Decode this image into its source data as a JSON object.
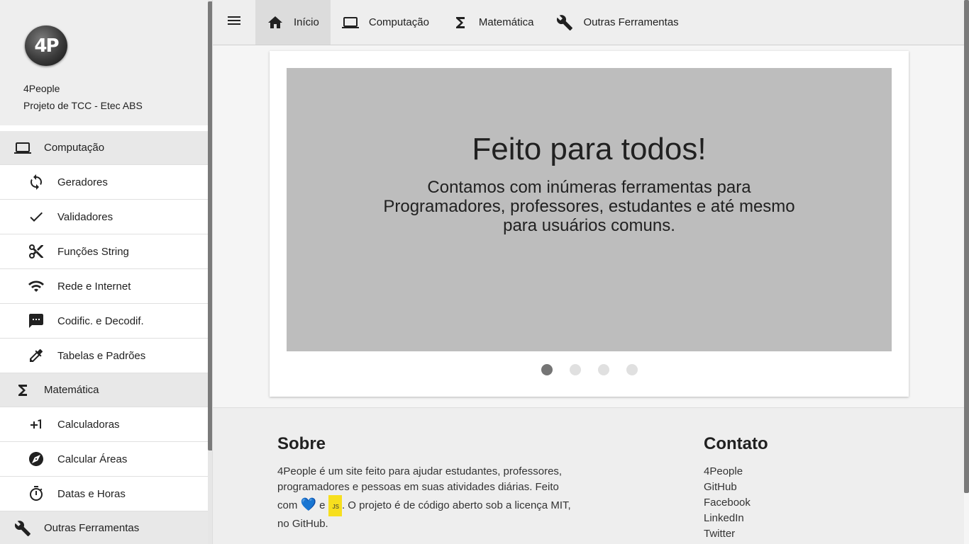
{
  "sidebar": {
    "profile": {
      "name": "4People",
      "subtitle": "Projeto de TCC - Etec ABS",
      "logo_text": "4P"
    },
    "sections": [
      {
        "label": "Computação",
        "icon": "laptop-icon",
        "items": [
          {
            "label": "Geradores",
            "icon": "refresh-icon"
          },
          {
            "label": "Validadores",
            "icon": "check-icon"
          },
          {
            "label": "Funções String",
            "icon": "scissors-icon"
          },
          {
            "label": "Rede e Internet",
            "icon": "wifi-icon"
          },
          {
            "label": "Codific. e Decodif.",
            "icon": "comment-icon"
          },
          {
            "label": "Tabelas e Padrões",
            "icon": "eyedropper-icon"
          }
        ]
      },
      {
        "label": "Matemática",
        "icon": "sigma-icon",
        "items": [
          {
            "label": "Calculadoras",
            "icon": "plus-one-icon"
          },
          {
            "label": "Calcular Áreas",
            "icon": "compass-icon"
          },
          {
            "label": "Datas e Horas",
            "icon": "timer-icon"
          }
        ]
      },
      {
        "label": "Outras Ferramentas",
        "icon": "wrench-icon",
        "items": []
      }
    ]
  },
  "topbar": {
    "menu_icon": "menu-icon",
    "tabs": [
      {
        "label": "Início",
        "icon": "home-icon",
        "active": true
      },
      {
        "label": "Computação",
        "icon": "laptop-icon",
        "active": false
      },
      {
        "label": "Matemática",
        "icon": "sigma-icon",
        "active": false
      },
      {
        "label": "Outras Ferramentas",
        "icon": "wrench-icon",
        "active": false
      }
    ]
  },
  "carousel": {
    "title": "Feito para todos!",
    "text": "Contamos com inúmeras ferramentas para Programadores, professores, estudantes e até mesmo para usuários comuns.",
    "slide_count": 4,
    "active_index": 0
  },
  "footer": {
    "about": {
      "title": "Sobre",
      "text_before": "4People é um site feito para ajudar estudantes, professores, programadores e pessoas em suas atividades diárias. Feito com",
      "text_mid": "e",
      "text_after": ". O projeto é de código aberto sob a licença MIT, no GitHub.",
      "heart_glyph": "💙",
      "js_badge": "JS"
    },
    "contact": {
      "title": "Contato",
      "links": [
        "4People",
        "GitHub",
        "Facebook",
        "LinkedIn",
        "Twitter"
      ]
    }
  },
  "colors": {
    "sidebar_section_bg": "#e8e8e8",
    "topbar_bg": "#eeeeee",
    "slide_bg": "#bdbdbd",
    "heart": "#1e88e5",
    "js_badge": "#f7df1e"
  }
}
